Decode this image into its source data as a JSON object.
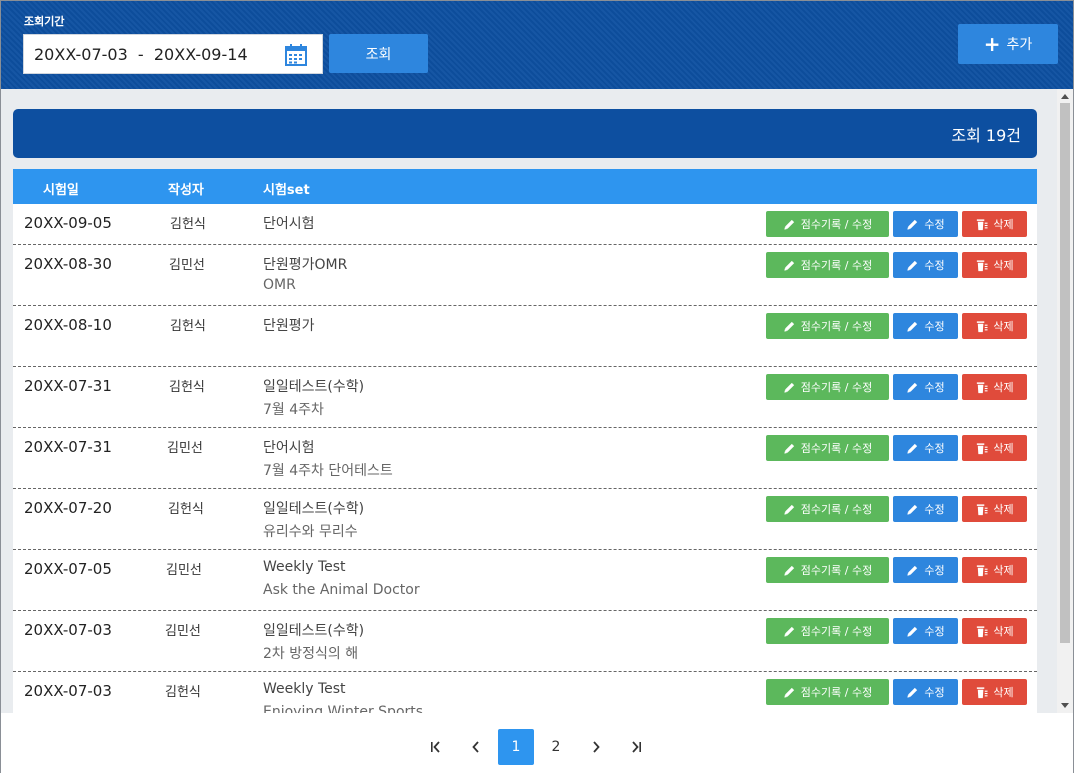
{
  "filter": {
    "period_label": "조회기간",
    "date_range": "20XX-07-03  -  20XX-09-14",
    "search_label": "조회",
    "add_label": "추가"
  },
  "summary": {
    "count_text": "조회 19건"
  },
  "table": {
    "headers": {
      "date": "시험일",
      "author": "작성자",
      "set": "시험set"
    },
    "rows": [
      {
        "date": "20XX-09-05",
        "author": "김헌식",
        "title": "단어시험",
        "sub": ""
      },
      {
        "date": "20XX-08-30",
        "author": "김민선",
        "title": "단원평가OMR",
        "sub": "OMR"
      },
      {
        "date": "20XX-08-10",
        "author": "김헌식",
        "title": "단원평가",
        "sub": ""
      },
      {
        "date": "20XX-07-31",
        "author": "김헌식",
        "title": "일일테스트(수학)",
        "sub": "7월 4주차"
      },
      {
        "date": "20XX-07-31",
        "author": "김민선",
        "title": "단어시험",
        "sub": "7월 4주차 단어테스트"
      },
      {
        "date": "20XX-07-20",
        "author": "김헌식",
        "title": "일일테스트(수학)",
        "sub": "유리수와 무리수"
      },
      {
        "date": "20XX-07-05",
        "author": "김민선",
        "title": "Weekly Test",
        "sub": "Ask the Animal Doctor"
      },
      {
        "date": "20XX-07-03",
        "author": "김민선",
        "title": "일일테스트(수학)",
        "sub": "2차 방정식의 해"
      },
      {
        "date": "20XX-07-03",
        "author": "김헌식",
        "title": "Weekly Test",
        "sub": "Enjoying Winter Sports"
      }
    ],
    "actions": {
      "score": "점수기록 / 수정",
      "edit": "수정",
      "delete": "삭제"
    }
  },
  "pagination": {
    "pages": [
      "1",
      "2"
    ],
    "current": "1"
  },
  "colors": {
    "header_bg": "#0d4fa0",
    "accent_blue": "#2e86de",
    "green": "#5cb85c",
    "red": "#e04b3b"
  }
}
